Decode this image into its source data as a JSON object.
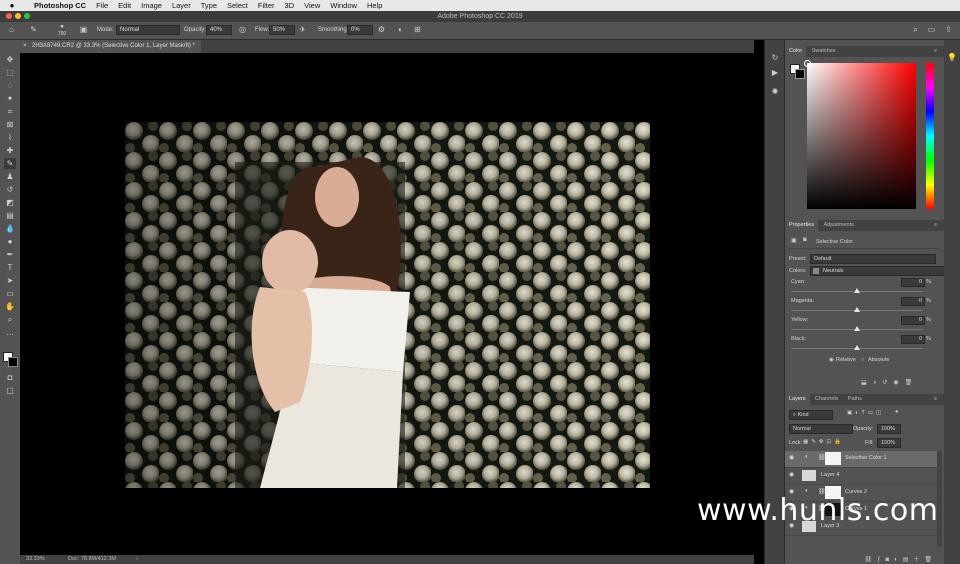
{
  "menubar": {
    "apple": "",
    "app_name": "Photoshop CC",
    "items": [
      "File",
      "Edit",
      "Image",
      "Layer",
      "Type",
      "Select",
      "Filter",
      "3D",
      "View",
      "Window",
      "Help"
    ]
  },
  "titlebar": {
    "title": "Adobe Photoshop CC 2019"
  },
  "options": {
    "brush_size": "700",
    "mode_label": "Mode:",
    "mode_value": "Normal",
    "opacity_label": "Opacity:",
    "opacity_value": "40%",
    "flow_label": "Flow:",
    "flow_value": "50%",
    "smoothing_label": "Smoothing:",
    "smoothing_value": "0%"
  },
  "document": {
    "tab_title": "2H3A8749.CR2 @ 33.3% (Selective Color 1, Layer Mask/8) *",
    "close_glyph": "×"
  },
  "status": {
    "zoom": "33.33%",
    "doc_size": "Doc: 78.8M/412.3M"
  },
  "color_panel": {
    "tabs": [
      "Color",
      "Swatches"
    ]
  },
  "properties": {
    "tabs": [
      "Properties",
      "Adjustments"
    ],
    "adjustment_name": "Selective Color",
    "preset_label": "Preset:",
    "preset_value": "Default",
    "colors_label": "Colors:",
    "colors_value": "Neutrals",
    "sliders": [
      {
        "label": "Cyan:",
        "value": "0",
        "unit": "%",
        "level": 0
      },
      {
        "label": "Magenta:",
        "value": "0",
        "unit": "%",
        "level": 0
      },
      {
        "label": "Yellow:",
        "value": "0",
        "unit": "%",
        "level": 0
      },
      {
        "label": "Black:",
        "value": "0",
        "unit": "%",
        "level": 0
      }
    ],
    "method_relative": "Relative",
    "method_absolute": "Absolute",
    "method_selected": "Relative"
  },
  "layers": {
    "tabs": [
      "Layers",
      "Channels",
      "Paths"
    ],
    "filter_kind": "Kind",
    "blend_mode": "Normal",
    "opacity_label": "Opacity:",
    "opacity_value": "100%",
    "lock_label": "Lock:",
    "fill_label": "Fill:",
    "fill_value": "100%",
    "items": [
      {
        "name": "Selective Color 1",
        "kind": "adjustment",
        "selected": true
      },
      {
        "name": "Layer 4",
        "kind": "pixel"
      },
      {
        "name": "Curves 2",
        "kind": "adjustment"
      },
      {
        "name": "Curves 1",
        "kind": "adjustment"
      },
      {
        "name": "Layer 3",
        "kind": "pixel"
      }
    ]
  },
  "watermark": "www.hunls.com",
  "colors": {
    "panel_bg": "#535353",
    "panel_dark": "#424242",
    "menubar_bg": "#e8e8e8",
    "selected_layer": "#6a6a6a"
  }
}
